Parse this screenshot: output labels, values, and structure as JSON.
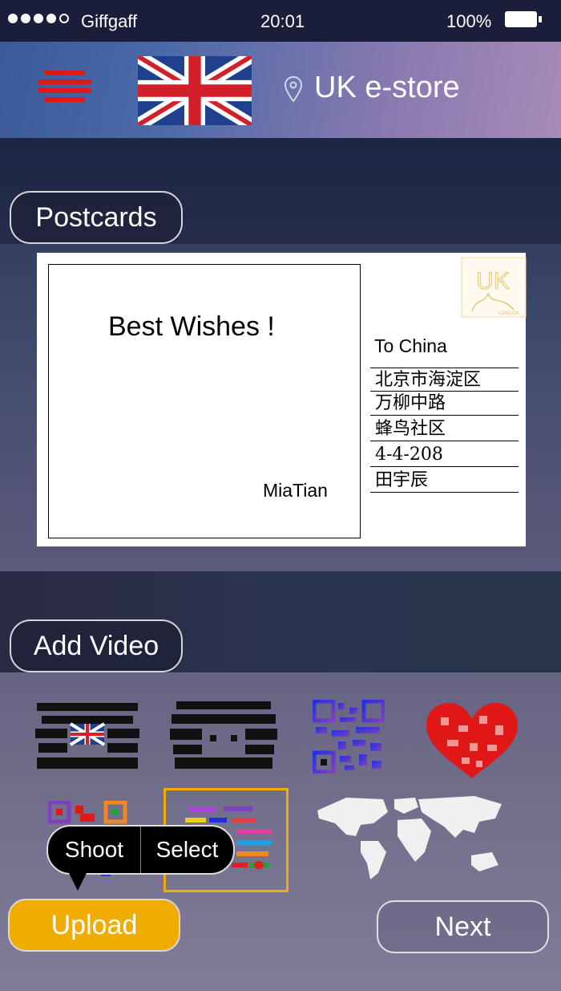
{
  "status_bar": {
    "carrier": "Giffgaff",
    "time": "20:01",
    "battery": "100%",
    "signal_bars_filled": 4,
    "signal_bars_total": 5
  },
  "header": {
    "title": "UK e-store",
    "menu_icon": "menu-icon",
    "flag_icon": "uk-flag-icon",
    "location_icon": "location-pin-icon",
    "accent_color": "#e01818"
  },
  "postcards": {
    "section_label": "Postcards",
    "greeting": "Best Wishes !",
    "signature": "MiaTian",
    "to_label": "To China",
    "address_lines": [
      "北京市海淀区",
      "万柳中路",
      "蜂鸟社区",
      "4-4-208",
      "田宇辰"
    ],
    "stamp_text": "UK",
    "stamp_subtext": "LONDON"
  },
  "video": {
    "section_label": "Add Video"
  },
  "qr_styles": [
    {
      "name": "qr-uk-flag",
      "icon": "qr-flag-icon"
    },
    {
      "name": "qr-black",
      "icon": "qr-icon"
    },
    {
      "name": "qr-blue-gradient",
      "icon": "qr-gradient-icon"
    },
    {
      "name": "qr-heart",
      "icon": "qr-heart-icon"
    },
    {
      "name": "qr-multicolor",
      "icon": "qr-color-icon"
    },
    {
      "name": "qr-rainbow-text",
      "icon": "qr-rainbow-icon"
    },
    {
      "name": "qr-world-map",
      "icon": "qr-map-icon"
    }
  ],
  "tooltip": {
    "shoot_label": "Shoot",
    "select_label": "Select"
  },
  "actions": {
    "upload_label": "Upload",
    "next_label": "Next",
    "upload_color": "#f0ad00"
  }
}
